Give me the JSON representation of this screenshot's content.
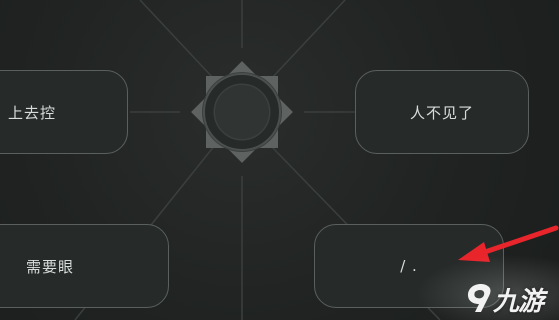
{
  "options": {
    "top_left": "上去控",
    "top_right": "人不见了",
    "bottom_left": "需要眼",
    "bottom_right": "/ ."
  },
  "center_icon": "gear-ring-icon",
  "annotation_icon": "red-arrow-icon",
  "watermark": {
    "logo_icon": "9game-logo-icon",
    "text": "九游"
  },
  "colors": {
    "background": "#1f2221",
    "bubble_fill": "#262b2a",
    "bubble_border": "#5a605e",
    "text": "#d8dcdb",
    "arrow": "#e8252b"
  }
}
